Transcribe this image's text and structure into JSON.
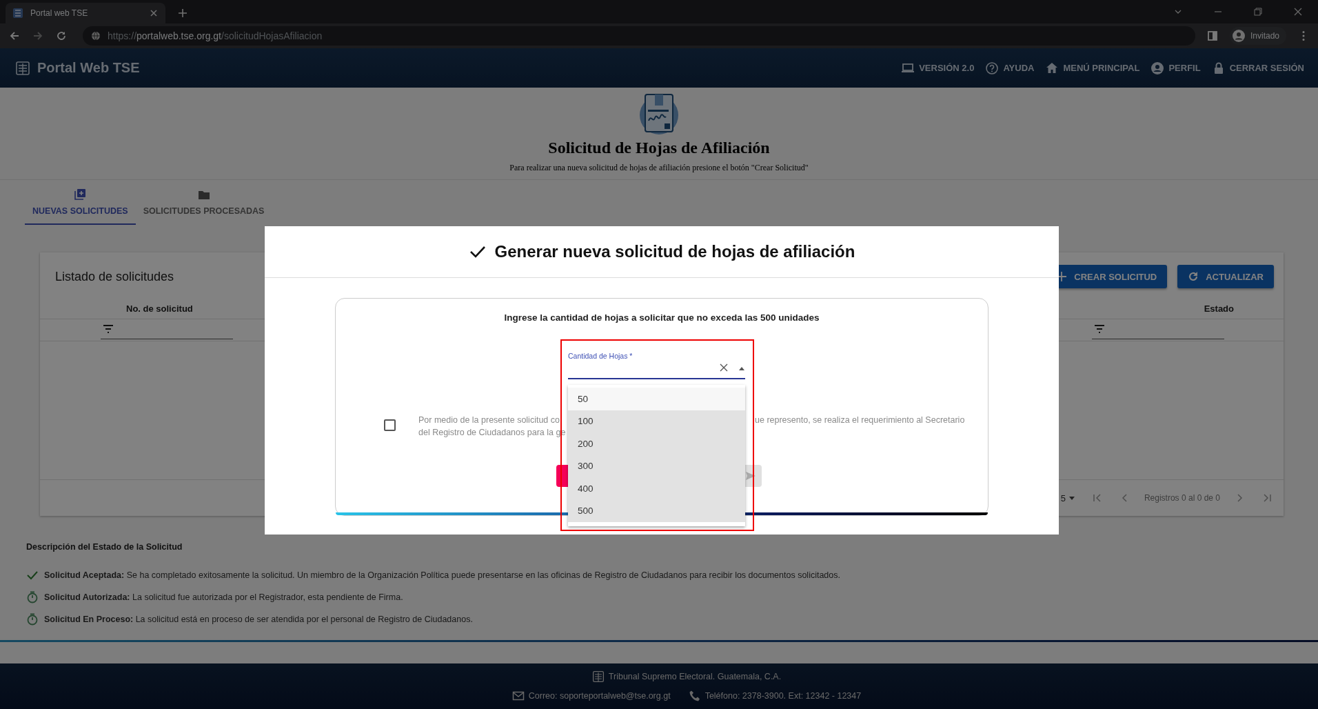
{
  "browser": {
    "tab_title": "Portal web TSE",
    "url": "https://**portalweb.tse.org.gt**/solicitudHojasAfiliacion",
    "profile": "Invitado"
  },
  "header": {
    "brand": "Portal Web TSE",
    "nav": [
      "VERSIÓN 2.0",
      "AYUDA",
      "MENÚ PRINCIPAL",
      "PERFIL",
      "CERRAR SESIÓN"
    ]
  },
  "hero": {
    "title": "Solicitud de Hojas de Afiliación",
    "subtitle": "Para realizar una nueva solicitud de hojas de afiliación presione el botón \"Crear Solicitud\""
  },
  "tabs": [
    {
      "label": "NUEVAS SOLICITUDES",
      "selected": true
    },
    {
      "label": "SOLICITUDES PROCESADAS",
      "selected": false
    }
  ],
  "list_card": {
    "title": "Listado de solicitudes",
    "buttons": [
      "CREAR SOLICITUD",
      "ACTUALIZAR"
    ],
    "columns": [
      "No. de solicitud",
      "Estado"
    ],
    "pagination": {
      "page_size": "5",
      "range": "Registros 0 al 0 de 0"
    }
  },
  "legend": {
    "title": "Descripción del Estado de la Solicitud",
    "items": [
      {
        "kind": "check",
        "text": "**Solicitud Aceptada:** Se ha completado exitosamente la solicitud. Un miembro de la Organización Política puede presentarse en las oficinas de Registro de Ciudadanos para recibir los documentos solicitados."
      },
      {
        "kind": "timer",
        "text": "**Solicitud Autorizada:** La solicitud fue autorizada por el Registrador, esta pendiente de Firma."
      },
      {
        "kind": "timer",
        "text": "**Solicitud En Proceso:** La solicitud está en proceso de ser atendida por el personal de Registro de Ciudadanos."
      }
    ]
  },
  "footer": {
    "org": "Tribunal Supremo Electoral. Guatemala, C.A.",
    "email": "Correo: soporteportalweb@tse.org.gt",
    "phone": "Teléfono: 2378-3900. Ext: 12342 - 12347"
  },
  "modal": {
    "title": "Generar nueva solicitud de hojas de afiliación",
    "instruction": "Ingrese la cantidad de hojas a solicitar que no exceda las 500 unidades",
    "field": {
      "label": "Cantidad de Hojas *",
      "expanded": true
    },
    "options": [
      {
        "label": "50",
        "highlighted": false
      },
      {
        "label": "100",
        "highlighted": true
      },
      {
        "label": "200",
        "highlighted": true
      },
      {
        "label": "300",
        "highlighted": true
      },
      {
        "label": "400",
        "highlighted": true
      },
      {
        "label": "500",
        "highlighted": true
      }
    ],
    "consent": {
      "checked": false,
      "left_lines": [
        "Por medio de la presente solicitud co",
        "del Registro de Ciudadanos para la ge"
      ],
      "right_line": "ue represento, se realiza el requerimiento al Secretario"
    },
    "send_disabled": true
  }
}
